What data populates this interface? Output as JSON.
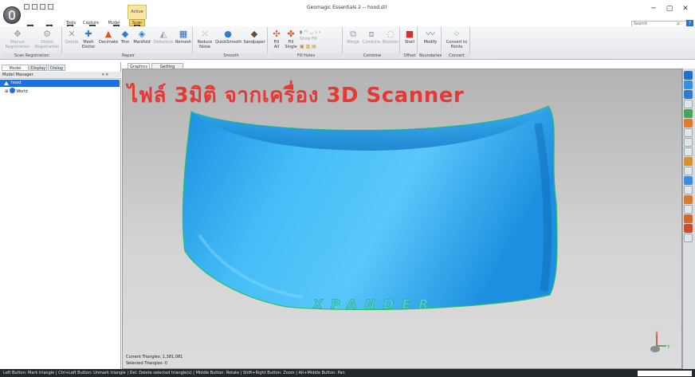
{
  "window": {
    "title": "Geomagic Essentials 2 -- hood.stl",
    "contextual_group": "Active",
    "search_placeholder": "Search",
    "help": "?",
    "controls": {
      "minimize": "─",
      "maximize": "▢",
      "close": "✕"
    }
  },
  "keytips": [
    "Y",
    "S",
    "T",
    "W",
    "M",
    "P"
  ],
  "tabs": [
    {
      "label": "Tools"
    },
    {
      "label": "Capture"
    },
    {
      "label": "Model"
    },
    {
      "label": "Scan",
      "active": true
    }
  ],
  "ribbon": {
    "groups": [
      {
        "label": "Scan Registration",
        "buttons": [
          {
            "label": "Manual Registration",
            "icon": "manual-registration-icon",
            "enabled": false
          },
          {
            "label": "Global Registration",
            "icon": "global-registration-icon",
            "enabled": false
          }
        ]
      },
      {
        "label": "Repair",
        "buttons": [
          {
            "label": "Delete",
            "icon": "delete-icon",
            "enabled": false
          },
          {
            "label": "Mesh Doctor",
            "icon": "mesh-doctor-icon",
            "enabled": true
          },
          {
            "label": "Decimate",
            "icon": "decimate-icon",
            "enabled": true
          },
          {
            "label": "Trim",
            "icon": "trim-icon",
            "enabled": true
          },
          {
            "label": "Manifold",
            "icon": "manifold-icon",
            "enabled": true
          },
          {
            "label": "Defeature",
            "icon": "defeature-icon",
            "enabled": false
          },
          {
            "label": "Remesh",
            "icon": "remesh-icon",
            "enabled": true
          }
        ]
      },
      {
        "label": "Smooth",
        "buttons": [
          {
            "label": "Reduce Noise",
            "icon": "reduce-noise-icon",
            "enabled": true
          },
          {
            "label": "QuickSmooth",
            "icon": "quicksmooth-icon",
            "enabled": true
          },
          {
            "label": "Sandpaper",
            "icon": "sandpaper-icon",
            "enabled": true
          }
        ]
      },
      {
        "label": "Fill Holes",
        "buttons": [
          {
            "label": "Fill All",
            "icon": "fill-all-icon",
            "enabled": true
          },
          {
            "label": "Fill Single",
            "icon": "fill-single-icon",
            "enabled": true
          },
          {
            "label": "Show Fill",
            "icon": "show-fill-icon",
            "enabled": false
          }
        ]
      },
      {
        "label": "Combine",
        "buttons": [
          {
            "label": "Merge",
            "icon": "merge-icon",
            "enabled": false
          },
          {
            "label": "Combine",
            "icon": "combine-icon",
            "enabled": false
          },
          {
            "label": "Boolean",
            "icon": "boolean-icon",
            "enabled": false
          }
        ]
      },
      {
        "label": "Offset",
        "buttons": [
          {
            "label": "Shell",
            "icon": "shell-icon",
            "enabled": true
          }
        ]
      },
      {
        "label": "Boundaries",
        "buttons": [
          {
            "label": "Modify",
            "icon": "modify-icon",
            "enabled": true
          }
        ]
      },
      {
        "label": "Convert",
        "buttons": [
          {
            "label": "Convert to Points",
            "icon": "convert-to-points-icon",
            "enabled": true
          }
        ]
      }
    ]
  },
  "left_panel": {
    "tabs": [
      "Model Manager",
      "Display",
      "Dialog"
    ],
    "header": "Model Manager",
    "header_controls": "▾ ✕",
    "tree": [
      {
        "label": "hood",
        "selected": true
      },
      {
        "label": "World",
        "selected": false
      }
    ]
  },
  "viewport": {
    "tabs": [
      "Graphics",
      "Getting Started"
    ],
    "overlay_title": "ไฟล์ 3มิติ จากเครื่อง 3D Scanner",
    "embossed_text": "XPANDER",
    "current_triangles": "Current Triangles: 1,381,081",
    "selected_triangles": "Selected Triangles: 0",
    "axes": {
      "x": "X",
      "y": "Y"
    },
    "model_color": "#28a8f2"
  },
  "status_bar": {
    "text": "Left Button: Mark triangle | Ctrl+Left Button: Unmark triangle | Del: Delete selected triangle(s) | Middle Button: Rotate | Shift+Right Button: Zoom | Alt+Middle Button: Pan"
  }
}
